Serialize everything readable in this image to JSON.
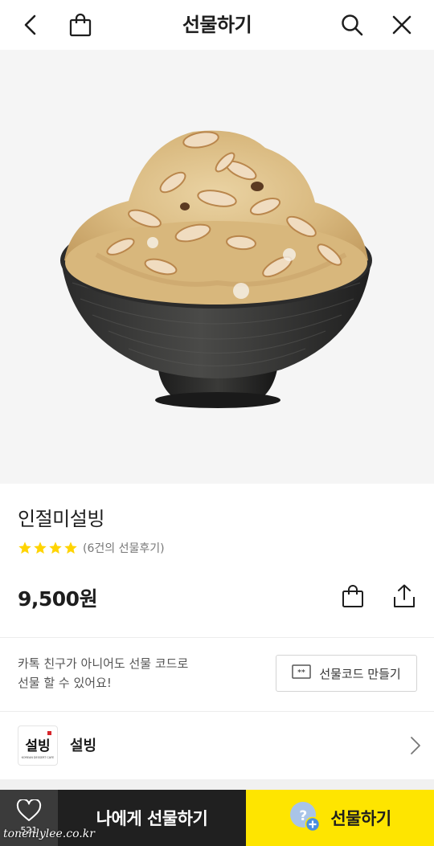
{
  "header": {
    "title": "선물하기",
    "icons": [
      "back-icon",
      "shopping-bag-icon",
      "search-icon",
      "close-icon"
    ]
  },
  "product": {
    "name": "인절미설빙",
    "rating_stars": 4,
    "review_count_text": "(6건의 선물후기)",
    "price": "9,500원"
  },
  "gift_code": {
    "line1": "카톡 친구가 아니어도 선물 코드로",
    "line2": "선물 할 수 있어요!",
    "button_label": "선물코드 만들기"
  },
  "brand": {
    "name": "설빙",
    "logo_text": "설빙",
    "logo_subtext": "KOREAN DESSERT CAFE"
  },
  "bottom_bar": {
    "like_count": "521",
    "gift_myself_label": "나에게 선물하기",
    "gift_label": "선물하기"
  },
  "watermark": "tonehlylee.co.kr",
  "colors": {
    "accent_yellow": "#fee500",
    "star": "#ffd400",
    "dark_button": "#202020",
    "like_button": "#3b3b3b",
    "text": "#1e1e1e"
  }
}
